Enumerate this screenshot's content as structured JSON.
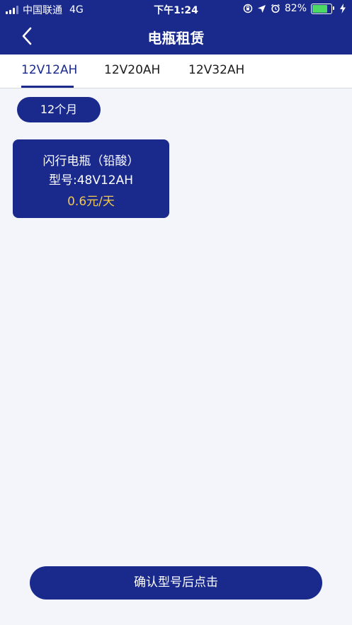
{
  "status_bar": {
    "carrier": "中国联通",
    "network": "4G",
    "time": "下午1:24",
    "battery": "82%",
    "battery_level": 0.82
  },
  "nav": {
    "title": "电瓶租赁",
    "back_icon": "chevron-left-icon"
  },
  "tabs": [
    {
      "label": "12V12AH",
      "active": true
    },
    {
      "label": "12V20AH",
      "active": false
    },
    {
      "label": "12V32AH",
      "active": false
    }
  ],
  "period": {
    "label": "12个月"
  },
  "products": [
    {
      "name": "闪行电瓶（铅酸）",
      "model": "型号:48V12AH",
      "price": "0.6元/天"
    }
  ],
  "confirm": {
    "label": "确认型号后点击"
  },
  "colors": {
    "primary": "#1a2a8c",
    "price": "#f2c94c",
    "background": "#f4f5fb"
  }
}
